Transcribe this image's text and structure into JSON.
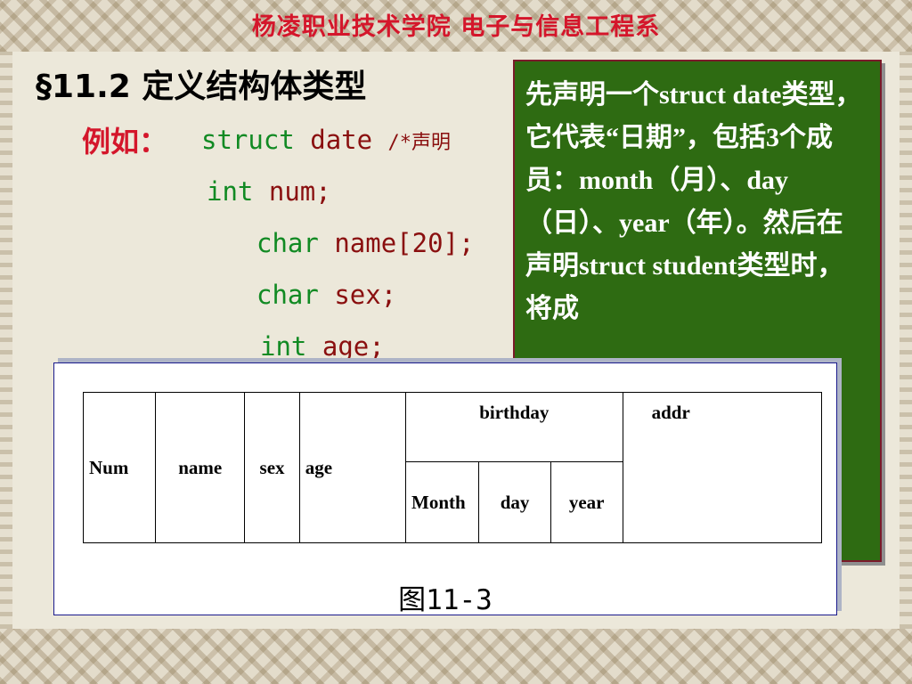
{
  "header": {
    "title": "杨凌职业技术学院  电子与信息工程系"
  },
  "section": {
    "title": "§11.2  定义结构体类型"
  },
  "example": {
    "label": "例如：",
    "line1_kw": "struct",
    "line1_name": "date",
    "line1_comment": "/*声明",
    "lines": [
      {
        "type": "int",
        "rest": "num;"
      },
      {
        "type": "char",
        "rest": "name[20];"
      },
      {
        "type": "char",
        "rest": "sex;"
      },
      {
        "type": "int",
        "rest": "age;"
      }
    ]
  },
  "callout": {
    "text": "先声明一个struct date类型，它代表“日期”，包括3个成员：month（月）、day（日）、year（年）。然后在声明struct student类型时，将成"
  },
  "figure": {
    "columns": [
      "Num",
      "name",
      "sex",
      "age"
    ],
    "birthday": {
      "label": "birthday",
      "sub": [
        "Month",
        "day",
        "year"
      ]
    },
    "addr": "addr",
    "caption": "图11-3"
  },
  "colors": {
    "header_red": "#d4162b",
    "code_green": "#118a23",
    "code_red": "#8a0f0f",
    "callout_bg": "#2e6b12"
  }
}
